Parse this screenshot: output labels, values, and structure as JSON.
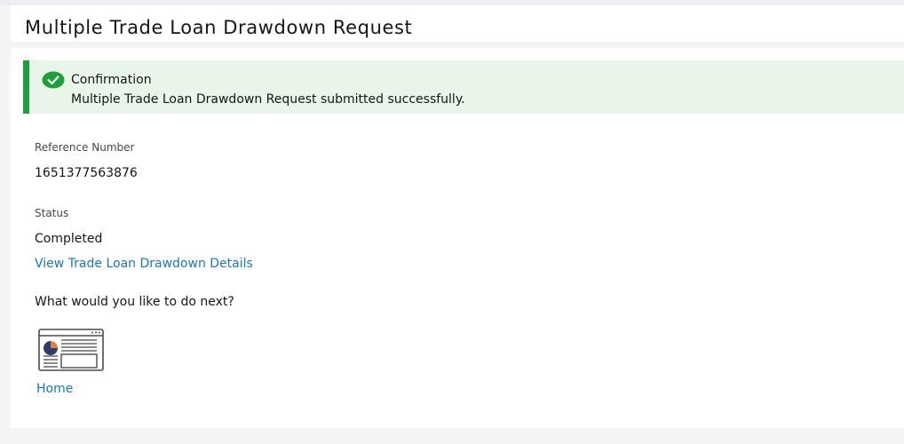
{
  "page": {
    "title": "Multiple Trade Loan Drawdown Request"
  },
  "confirmation": {
    "title": "Confirmation",
    "message": "Multiple Trade Loan Drawdown Request submitted successfully.",
    "accent_color": "#1e9f3a",
    "background_color": "#eaf5ea",
    "icon": "check-circle-icon"
  },
  "details": {
    "reference_label": "Reference Number",
    "reference_value": "1651377563876",
    "status_label": "Status",
    "status_value": "Completed",
    "view_details_link": "View Trade Loan Drawdown Details"
  },
  "next_actions": {
    "prompt": "What would you like to do next?",
    "items": [
      {
        "label": "Home",
        "icon": "dashboard-window-icon"
      }
    ]
  },
  "colors": {
    "link": "#1a77b8",
    "page_background": "#f4f4f6",
    "icon_accent_orange": "#e87e3c",
    "icon_accent_navy": "#2c3e6b"
  }
}
